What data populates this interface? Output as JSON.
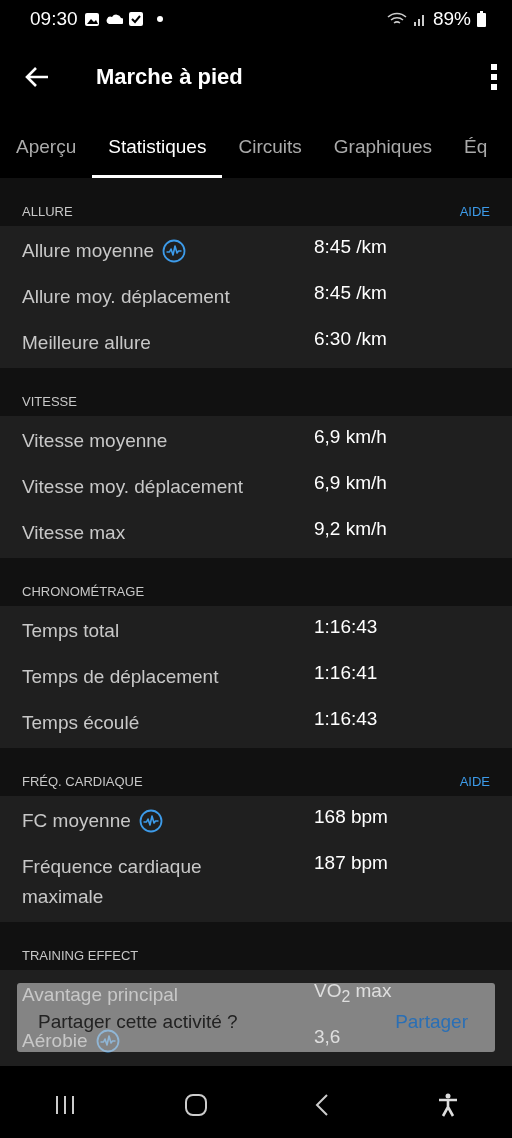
{
  "status_bar": {
    "time": "09:30",
    "battery": "89%"
  },
  "app_bar": {
    "title": "Marche à pied"
  },
  "tabs": [
    {
      "label": "Aperçu",
      "selected": false
    },
    {
      "label": "Statistiques",
      "selected": true
    },
    {
      "label": "Circuits",
      "selected": false
    },
    {
      "label": "Graphiques",
      "selected": false
    },
    {
      "label": "Éq",
      "selected": false
    }
  ],
  "sections": [
    {
      "title": "ALLURE",
      "help": "AIDE",
      "rows": [
        {
          "label": "Allure moyenne",
          "value": "8:45 /km",
          "info": true
        },
        {
          "label": "Allure moy. déplacement",
          "value": "8:45 /km",
          "info": false
        },
        {
          "label": "Meilleure allure",
          "value": "6:30 /km",
          "info": false
        }
      ]
    },
    {
      "title": "VITESSE",
      "rows": [
        {
          "label": "Vitesse moyenne",
          "value": "6,9 km/h",
          "info": false
        },
        {
          "label": "Vitesse moy. déplacement",
          "value": "6,9 km/h",
          "info": false
        },
        {
          "label": "Vitesse max",
          "value": "9,2 km/h",
          "info": false
        }
      ]
    },
    {
      "title": "CHRONOMÉTRAGE",
      "rows": [
        {
          "label": "Temps total",
          "value": "1:16:43",
          "info": false
        },
        {
          "label": "Temps de déplacement",
          "value": "1:16:41",
          "info": false
        },
        {
          "label": "Temps écoulé",
          "value": "1:16:43",
          "info": false
        }
      ]
    },
    {
      "title": "FRÉQ. CARDIAQUE",
      "help": "AIDE",
      "rows": [
        {
          "label": "FC moyenne",
          "value": "168 bpm",
          "info": true
        },
        {
          "label": "Fréquence cardiaque maximale",
          "value": "187 bpm",
          "info": false
        }
      ]
    },
    {
      "title": "TRAINING EFFECT",
      "rows": [
        {
          "label": "Avantage principal",
          "value": "VO$_{2}$ max",
          "info": false
        },
        {
          "label": "Aérobie",
          "value": "3,6",
          "info": true
        }
      ]
    }
  ],
  "snackbar": {
    "message": "Partager cette activité ?",
    "action": "Partager"
  }
}
